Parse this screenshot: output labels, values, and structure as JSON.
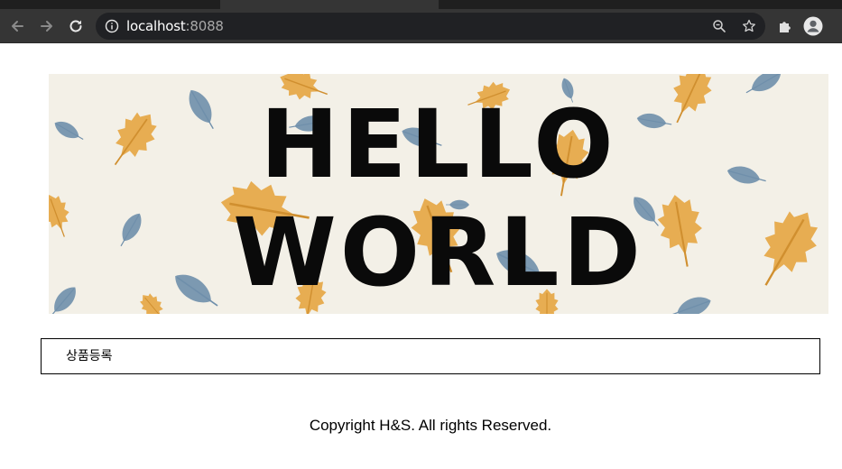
{
  "browser": {
    "url_host": "localhost",
    "url_port": ":8088",
    "icons": {
      "back": "back-arrow-icon",
      "forward": "forward-arrow-icon",
      "reload": "reload-icon",
      "info": "info-icon",
      "zoom": "zoom-icon",
      "bookmark": "star-icon",
      "extensions": "puzzle-icon",
      "profile": "profile-icon"
    }
  },
  "banner": {
    "line1": "HELLO",
    "line2": "WORLD",
    "colors": {
      "background": "#f3f0e7",
      "leaf_blue": "#6f8fab",
      "leaf_orange": "#e6a94a",
      "text": "#0a0a0a"
    }
  },
  "menu": {
    "items": [
      {
        "label": "상품등록"
      }
    ]
  },
  "footer": {
    "text": "Copyright H&S. All rights Reserved."
  }
}
